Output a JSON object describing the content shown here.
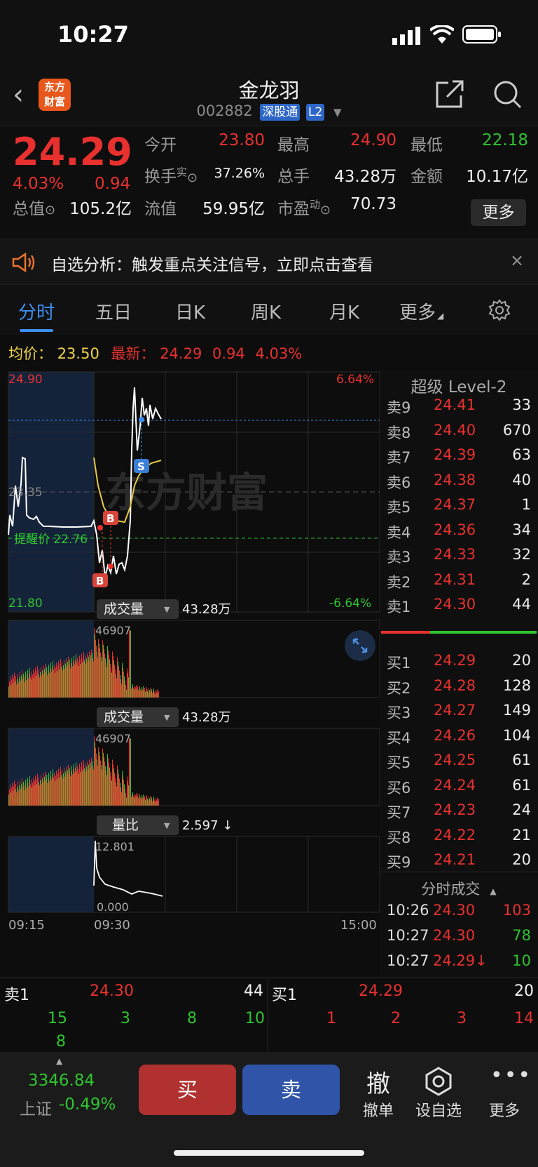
{
  "status_bar": {
    "time": "10:27"
  },
  "nav": {
    "back": "‹",
    "logo_line1": "东方",
    "logo_line2": "财富",
    "stock_name": "金龙羽",
    "stock_code": "002882",
    "tag1": "深股通",
    "tag2": "L2"
  },
  "quote": {
    "price": "24.29",
    "pct": "4.03%",
    "change": "0.94",
    "open_label": "今开",
    "open": "23.80",
    "high_label": "最高",
    "high": "24.90",
    "low_label": "最低",
    "low": "22.18",
    "turnover_label": "换手",
    "turnover_sup": "实",
    "turnover": "37.26%",
    "volume_label": "总手",
    "volume": "43.28万",
    "amount_label": "金额",
    "amount": "10.17亿",
    "mktcap_label": "总值",
    "mktcap": "105.2亿",
    "float_label": "流值",
    "float": "59.95亿",
    "pe_label": "市盈",
    "pe_sup": "动",
    "pe": "70.73",
    "more": "更多"
  },
  "alert": {
    "text": "自选分析：触发重点关注信号，立即点击查看",
    "close": "×"
  },
  "tabs": [
    "分时",
    "五日",
    "日K",
    "周K",
    "月K",
    "更多"
  ],
  "avg_row": {
    "avg_label": "均价：",
    "avg": "23.50",
    "latest_label": "最新：",
    "latest": "24.29",
    "change": "0.94",
    "pct": "4.03%"
  },
  "chart": {
    "top_price": "24.90",
    "top_pct": "6.64%",
    "mid_price": "23.35",
    "alert_label": "提醒价 22.76",
    "bottom_price": "21.80",
    "bottom_pct": "-6.64%",
    "watermark": "东方财富",
    "vol1_label": "成交量",
    "vol1_value": "43.28万",
    "vol1_max": "46907",
    "vol2_label": "成交量",
    "vol2_value": "43.28万",
    "vol2_max": "46907",
    "ratio_label": "量比",
    "ratio_value": "2.597 ↓",
    "ratio_max": "12.801",
    "ratio_min": "0.000",
    "time_start": "09:15",
    "time_open": "09:30",
    "time_end": "15:00",
    "marker_b": "B",
    "marker_s": "S"
  },
  "level2": {
    "title": "超级 Level-2",
    "asks": [
      {
        "label": "卖9",
        "price": "24.41",
        "vol": "33"
      },
      {
        "label": "卖8",
        "price": "24.40",
        "vol": "670"
      },
      {
        "label": "卖7",
        "price": "24.39",
        "vol": "63"
      },
      {
        "label": "卖6",
        "price": "24.38",
        "vol": "40"
      },
      {
        "label": "卖5",
        "price": "24.37",
        "vol": "1"
      },
      {
        "label": "卖4",
        "price": "24.36",
        "vol": "34"
      },
      {
        "label": "卖3",
        "price": "24.33",
        "vol": "32"
      },
      {
        "label": "卖2",
        "price": "24.31",
        "vol": "2"
      },
      {
        "label": "卖1",
        "price": "24.30",
        "vol": "44"
      }
    ],
    "bids": [
      {
        "label": "买1",
        "price": "24.29",
        "vol": "20"
      },
      {
        "label": "买2",
        "price": "24.28",
        "vol": "128"
      },
      {
        "label": "买3",
        "price": "24.27",
        "vol": "149"
      },
      {
        "label": "买4",
        "price": "24.26",
        "vol": "104"
      },
      {
        "label": "买5",
        "price": "24.25",
        "vol": "61"
      },
      {
        "label": "买6",
        "price": "24.24",
        "vol": "61"
      },
      {
        "label": "买7",
        "price": "24.23",
        "vol": "24"
      },
      {
        "label": "买8",
        "price": "24.22",
        "vol": "21"
      },
      {
        "label": "买9",
        "price": "24.21",
        "vol": "20"
      }
    ]
  },
  "ticks": {
    "title": "分时成交",
    "rows": [
      {
        "time": "10:26",
        "price": "24.30",
        "vol": "103"
      },
      {
        "time": "10:27",
        "price": "24.30",
        "vol": "78"
      },
      {
        "time": "10:27",
        "price": "24.29↓",
        "vol": "10"
      }
    ]
  },
  "orderbook": {
    "sell_label": "卖1",
    "sell_price": "24.30",
    "sell_vol": "44",
    "buy_label": "买1",
    "buy_price": "24.29",
    "buy_vol": "20",
    "sell_queue": [
      "15",
      "3",
      "8",
      "10"
    ],
    "sell_queue_extra": "8",
    "buy_queue": [
      "1",
      "2",
      "3",
      "14"
    ]
  },
  "bottom": {
    "index_value": "3346.84",
    "index_name": "上证",
    "index_pct": "-0.49%",
    "buy": "买",
    "sell": "卖",
    "cancel_icon": "撤",
    "cancel_label": "撤单",
    "watch_label": "设自选",
    "more_label": "更多"
  }
}
